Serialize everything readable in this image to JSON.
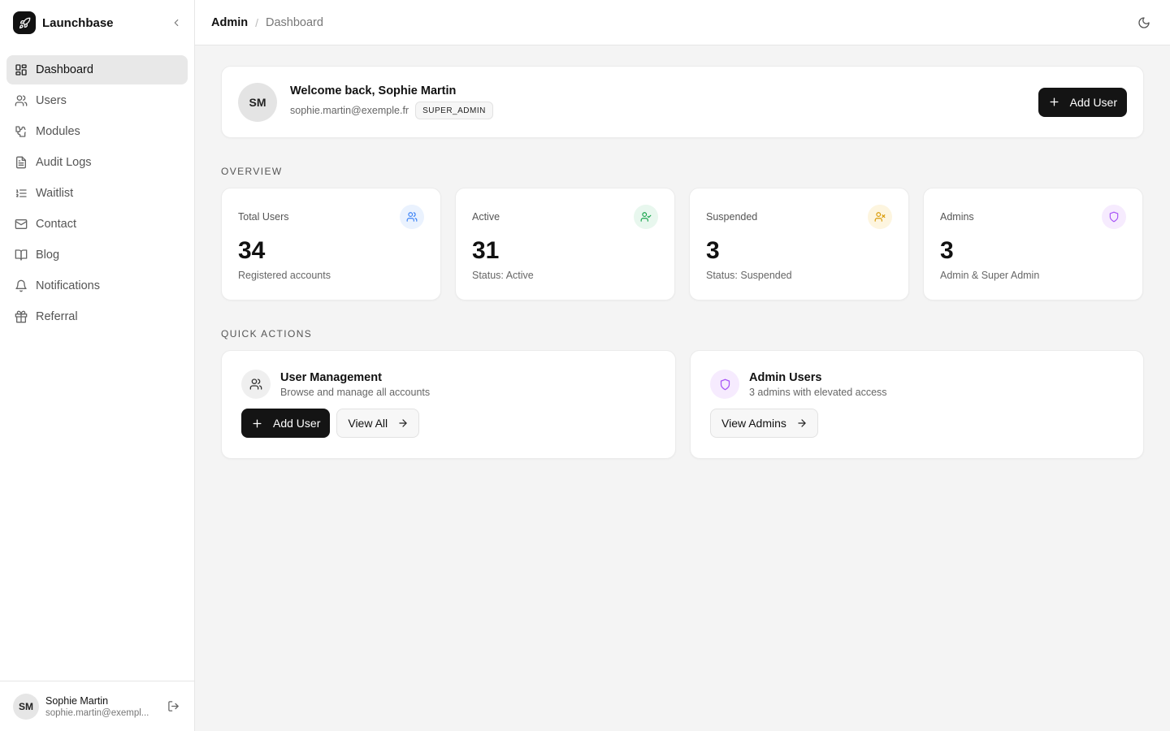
{
  "brand": {
    "name": "Launchbase"
  },
  "sidebar": {
    "items": [
      {
        "label": "Dashboard",
        "icon": "dashboard-icon",
        "active": true
      },
      {
        "label": "Users",
        "icon": "users-icon"
      },
      {
        "label": "Modules",
        "icon": "puzzle-icon"
      },
      {
        "label": "Audit Logs",
        "icon": "file-text-icon"
      },
      {
        "label": "Waitlist",
        "icon": "list-ordered-icon"
      },
      {
        "label": "Contact",
        "icon": "mail-icon"
      },
      {
        "label": "Blog",
        "icon": "book-open-icon"
      },
      {
        "label": "Notifications",
        "icon": "bell-icon"
      },
      {
        "label": "Referral",
        "icon": "gift-icon"
      }
    ],
    "user": {
      "initials": "SM",
      "name": "Sophie Martin",
      "email": "sophie.martin@exempl..."
    }
  },
  "header": {
    "crumb_root": "Admin",
    "separator": "/",
    "crumb_current": "Dashboard"
  },
  "welcome": {
    "initials": "SM",
    "title": "Welcome back, Sophie Martin",
    "email": "sophie.martin@exemple.fr",
    "role": "SUPER_ADMIN",
    "add_user_label": "Add User"
  },
  "overview": {
    "title": "OVERVIEW",
    "cards": [
      {
        "label": "Total Users",
        "value": "34",
        "sub": "Registered accounts",
        "icon": "users-icon",
        "color": "#3b82f6",
        "bg": "#eaf2fe"
      },
      {
        "label": "Active",
        "value": "31",
        "sub": "Status: Active",
        "icon": "user-check-icon",
        "color": "#16a34a",
        "bg": "#e8f7ee"
      },
      {
        "label": "Suspended",
        "value": "3",
        "sub": "Status: Suspended",
        "icon": "user-x-icon",
        "color": "#d99a06",
        "bg": "#fdf5df"
      },
      {
        "label": "Admins",
        "value": "3",
        "sub": "Admin & Super Admin",
        "icon": "shield-icon",
        "color": "#a855f7",
        "bg": "#f6ebfe"
      }
    ]
  },
  "quick_actions": {
    "title": "QUICK ACTIONS",
    "user_mgmt": {
      "title": "User Management",
      "desc": "Browse and manage all accounts",
      "add_label": "Add User",
      "view_label": "View All"
    },
    "admin_users": {
      "title": "Admin Users",
      "desc": "3 admins with elevated access",
      "view_label": "View Admins"
    }
  },
  "colors": {
    "accent": "#141414",
    "background": "#f4f4f4",
    "border": "#ebebeb"
  }
}
